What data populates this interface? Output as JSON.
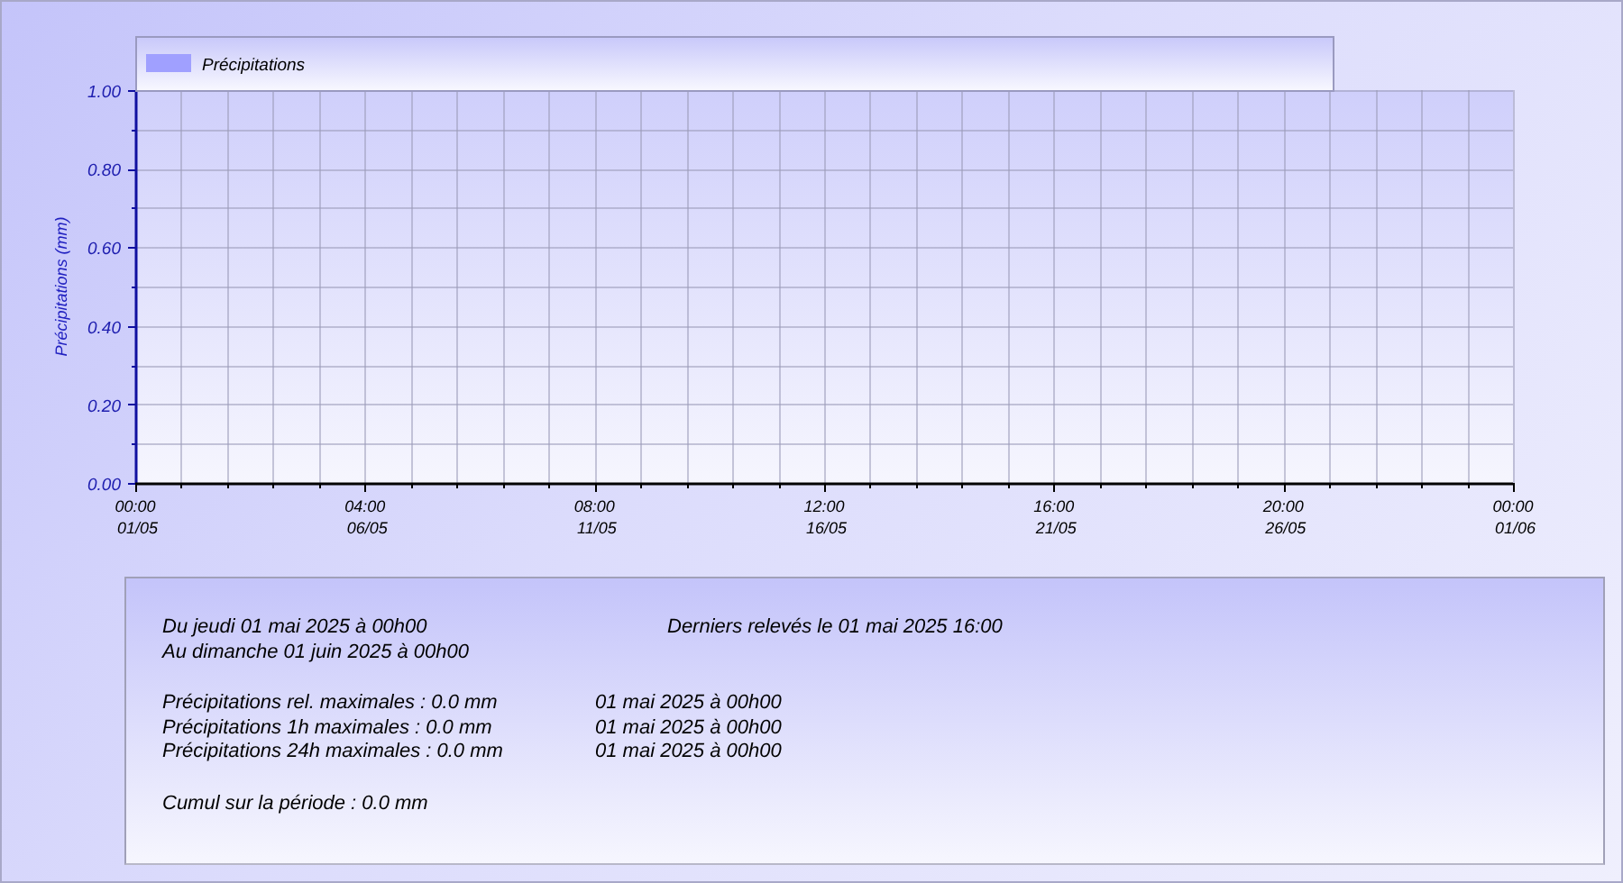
{
  "chart": {
    "chart_data": {
      "type": "area",
      "ylabel": "Précipitations (mm)",
      "grid": true,
      "categories": [
        "00:00 01/05",
        "04:00 06/05",
        "08:00 11/05",
        "12:00 16/05",
        "16:00 21/05",
        "20:00 26/05",
        "00:00 01/06"
      ],
      "series": [
        {
          "name": "Précipitations",
          "color": "#a0a0ff",
          "values": [
            null,
            null,
            null,
            null,
            null,
            null,
            null
          ]
        }
      ],
      "ylim": [
        0,
        1
      ],
      "yticks": [
        {
          "value": 0,
          "label": "0.00"
        },
        {
          "value": 0.2,
          "label": "0.20"
        },
        {
          "value": 0.4,
          "label": "0.40"
        },
        {
          "value": 0.6,
          "label": "0.60"
        },
        {
          "value": 0.8,
          "label": "0.80"
        },
        {
          "value": 1,
          "label": "1.00"
        }
      ]
    }
  },
  "summary": {
    "period_start": "Du jeudi 01 mai 2025 à 00h00",
    "last_reading": "Derniers relevés le 01 mai 2025 16:00",
    "period_end": "Au dimanche 01 juin 2025 à 00h00",
    "maxima": [
      {
        "label": "Précipitations rel. maximales : 0.0 mm",
        "date": "01 mai 2025 à 00h00"
      },
      {
        "label": "Précipitations 1h maximales : 0.0 mm",
        "date": "01 mai 2025 à 00h00"
      },
      {
        "label": "Précipitations 24h maximales : 0.0 mm",
        "date": "01 mai 2025 à 00h00"
      }
    ],
    "total": "Cumul sur la période : 0.0 mm"
  }
}
